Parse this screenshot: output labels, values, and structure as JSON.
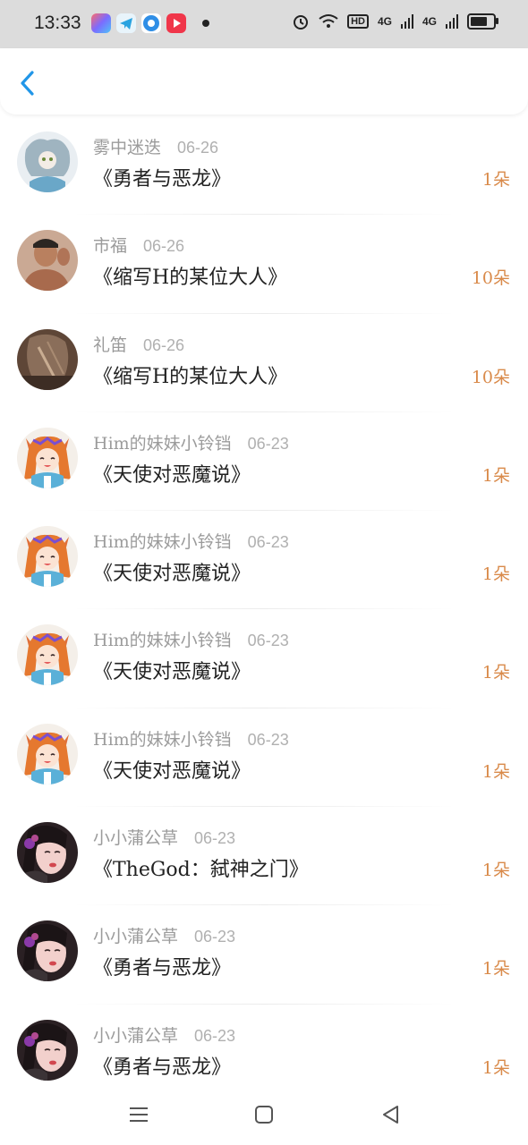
{
  "status": {
    "time": "13:33",
    "hd_label": "HD",
    "net1": "4G",
    "net2": "4G"
  },
  "records": [
    {
      "user": "雾中迷迭",
      "date": "06-26",
      "title": "《勇者与恶龙》",
      "count": "1朵",
      "avatar": "avatar-1"
    },
    {
      "user": "市福",
      "date": "06-26",
      "title": "《缩写H的某位大人》",
      "count": "10朵",
      "avatar": "avatar-2"
    },
    {
      "user": "礼笛",
      "date": "06-26",
      "title": "《缩写H的某位大人》",
      "count": "10朵",
      "avatar": "avatar-3"
    },
    {
      "user": "Him的妹妹小铃铛",
      "date": "06-23",
      "title": "《天使对恶魔说》",
      "count": "1朵",
      "avatar": "avatar-4"
    },
    {
      "user": "Him的妹妹小铃铛",
      "date": "06-23",
      "title": "《天使对恶魔说》",
      "count": "1朵",
      "avatar": "avatar-4"
    },
    {
      "user": "Him的妹妹小铃铛",
      "date": "06-23",
      "title": "《天使对恶魔说》",
      "count": "1朵",
      "avatar": "avatar-4"
    },
    {
      "user": "Him的妹妹小铃铛",
      "date": "06-23",
      "title": "《天使对恶魔说》",
      "count": "1朵",
      "avatar": "avatar-4"
    },
    {
      "user": "小小蒲公草",
      "date": "06-23",
      "title": "《TheGod：弑神之门》",
      "count": "1朵",
      "avatar": "avatar-5"
    },
    {
      "user": "小小蒲公草",
      "date": "06-23",
      "title": "《勇者与恶龙》",
      "count": "1朵",
      "avatar": "avatar-5"
    },
    {
      "user": "小小蒲公草",
      "date": "06-23",
      "title": "《勇者与恶龙》",
      "count": "1朵",
      "avatar": "avatar-5"
    }
  ],
  "colors": {
    "accent": "#2196e8",
    "count": "#d98a4a"
  }
}
